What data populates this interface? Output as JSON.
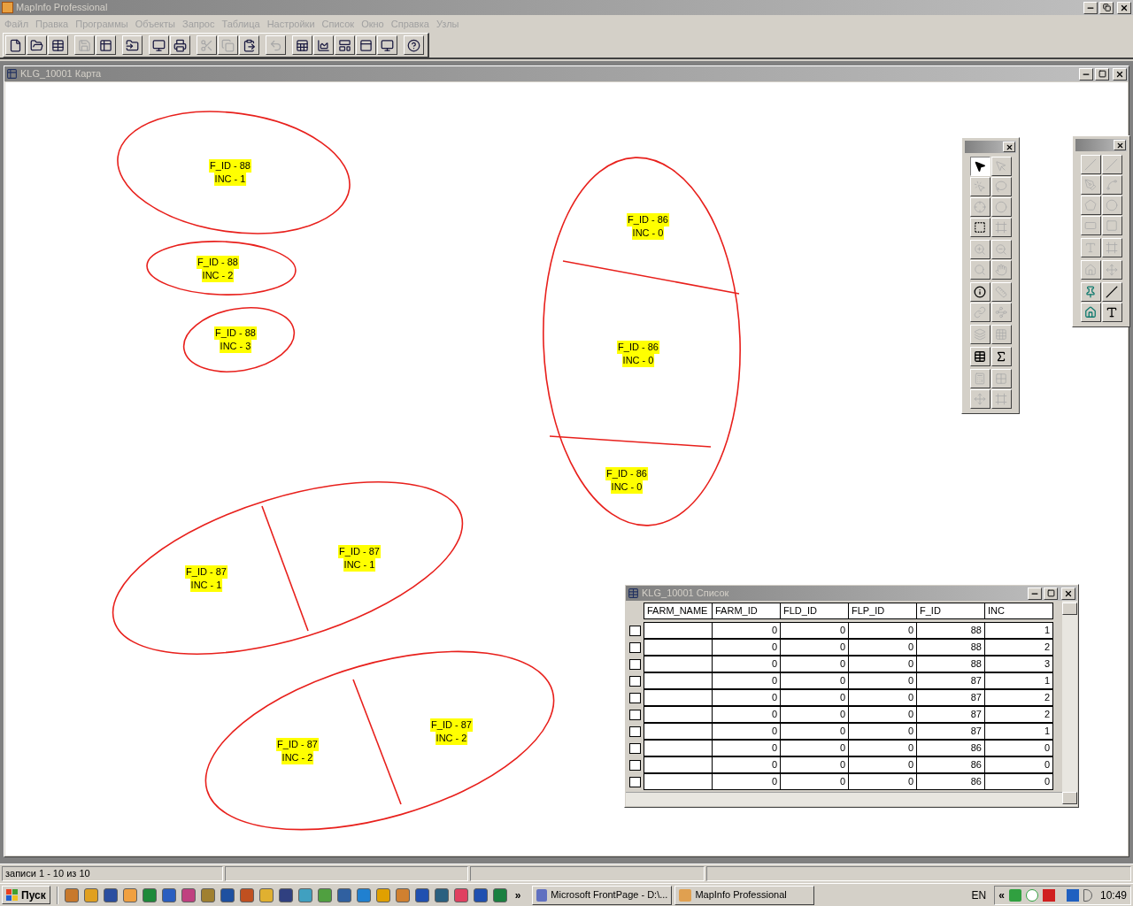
{
  "app_window": {
    "title": "MapInfo Professional",
    "active": false
  },
  "menu": [
    {
      "label": "Файл"
    },
    {
      "label": "Правка"
    },
    {
      "label": "Программы"
    },
    {
      "label": "Объекты"
    },
    {
      "label": "Запрос"
    },
    {
      "label": "Таблица"
    },
    {
      "label": "Настройки"
    },
    {
      "label": "Список"
    },
    {
      "label": "Окно"
    },
    {
      "label": "Справка"
    },
    {
      "label": "Узлы"
    }
  ],
  "toolbar": [
    {
      "disabled": false
    },
    {
      "disabled": false
    },
    {
      "disabled": false
    },
    {
      "disabled": true
    },
    {
      "disabled": false
    },
    {
      "disabled": false
    },
    {
      "disabled": false
    },
    {
      "disabled": false
    },
    {
      "disabled": true
    },
    {
      "disabled": true
    },
    {
      "disabled": false
    },
    {
      "disabled": true
    },
    {
      "disabled": false
    },
    {
      "disabled": false
    },
    {
      "disabled": false
    },
    {
      "disabled": false
    },
    {
      "disabled": false
    },
    {
      "disabled": false
    }
  ],
  "map_window": {
    "title": "KLG_10001 Карта",
    "labels": [
      {
        "lines": [
          "F_ID - 88",
          "INC - 1"
        ]
      },
      {
        "lines": [
          "F_ID - 88",
          "INC - 2"
        ]
      },
      {
        "lines": [
          "F_ID - 88",
          "INC - 3"
        ]
      },
      {
        "lines": [
          "F_ID - 86",
          "INC - 0"
        ]
      },
      {
        "lines": [
          "F_ID - 86",
          "INC - 0"
        ]
      },
      {
        "lines": [
          "F_ID - 86",
          "INC - 0"
        ]
      },
      {
        "lines": [
          "F_ID - 87",
          "INC - 1"
        ]
      },
      {
        "lines": [
          "F_ID - 87",
          "INC - 1"
        ]
      },
      {
        "lines": [
          "F_ID - 87",
          "INC - 2"
        ]
      },
      {
        "lines": [
          "F_ID - 87",
          "INC - 2"
        ]
      }
    ]
  },
  "main_palette": {
    "tools": [
      {
        "selected": true,
        "disabled": false
      },
      {
        "selected": false,
        "disabled": true
      },
      {
        "selected": false,
        "disabled": true
      },
      {
        "selected": false,
        "disabled": true
      },
      {
        "selected": false,
        "disabled": true
      },
      {
        "selected": false,
        "disabled": true
      },
      {
        "selected": false,
        "disabled": false
      },
      {
        "selected": false,
        "disabled": true
      },
      {
        "selected": false,
        "disabled": true
      },
      {
        "selected": false,
        "disabled": true
      },
      {
        "selected": false,
        "disabled": true
      },
      {
        "selected": false,
        "disabled": true
      },
      {
        "selected": false,
        "disabled": false
      },
      {
        "selected": false,
        "disabled": true
      },
      {
        "selected": false,
        "disabled": true
      },
      {
        "selected": false,
        "disabled": true
      },
      {
        "selected": false,
        "disabled": true
      },
      {
        "selected": false,
        "disabled": true
      },
      {
        "selected": false,
        "disabled": false
      },
      {
        "selected": false,
        "disabled": false
      },
      {
        "selected": false,
        "disabled": true
      },
      {
        "selected": false,
        "disabled": true
      },
      {
        "selected": false,
        "disabled": true
      },
      {
        "selected": false,
        "disabled": true
      }
    ]
  },
  "drawing_palette": {
    "tools": [
      {
        "disabled": true
      },
      {
        "disabled": true
      },
      {
        "disabled": true
      },
      {
        "disabled": true
      },
      {
        "disabled": true
      },
      {
        "disabled": true
      },
      {
        "disabled": true
      },
      {
        "disabled": true
      },
      {
        "disabled": true
      },
      {
        "disabled": true
      },
      {
        "disabled": true
      },
      {
        "disabled": true
      },
      {
        "disabled": false
      },
      {
        "disabled": false
      },
      {
        "disabled": false
      },
      {
        "disabled": false
      }
    ]
  },
  "browser_window": {
    "title": "KLG_10001 Список",
    "columns": [
      "FARM_NAME",
      "FARM_ID",
      "FLD_ID",
      "FLP_ID",
      "F_ID",
      "INC"
    ],
    "rows": [
      {
        "selected": false,
        "cells": [
          "0",
          "0",
          "0",
          "88",
          "1"
        ]
      },
      {
        "selected": false,
        "cells": [
          "0",
          "0",
          "0",
          "88",
          "2"
        ]
      },
      {
        "selected": false,
        "cells": [
          "0",
          "0",
          "0",
          "88",
          "3"
        ]
      },
      {
        "selected": false,
        "cells": [
          "0",
          "0",
          "0",
          "87",
          "1"
        ]
      },
      {
        "selected": false,
        "cells": [
          "0",
          "0",
          "0",
          "87",
          "2"
        ]
      },
      {
        "selected": false,
        "cells": [
          "0",
          "0",
          "0",
          "87",
          "2"
        ]
      },
      {
        "selected": false,
        "cells": [
          "0",
          "0",
          "0",
          "87",
          "1"
        ]
      },
      {
        "selected": false,
        "cells": [
          "0",
          "0",
          "0",
          "86",
          "0"
        ]
      },
      {
        "selected": false,
        "cells": [
          "0",
          "0",
          "0",
          "86",
          "0"
        ]
      },
      {
        "selected": false,
        "cells": [
          "0",
          "0",
          "0",
          "86",
          "0"
        ]
      }
    ]
  },
  "status_bar": {
    "text": "записи 1 - 10 из 10"
  },
  "taskbar": {
    "start": "Пуск",
    "more": "»",
    "tasks": [
      {
        "label": "Microsoft FrontPage - D:\\...",
        "selected": false
      },
      {
        "label": "MapInfo Professional",
        "selected": false
      }
    ],
    "language": "EN",
    "tray_expand": "«",
    "clock": "10:49"
  }
}
